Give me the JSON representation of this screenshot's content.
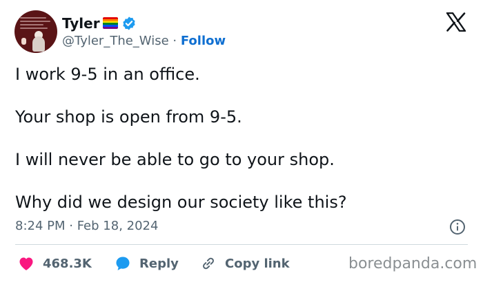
{
  "author": {
    "display_name": "Tyler",
    "handle": "@Tyler_The_Wise",
    "separator": "·",
    "follow_label": "Follow",
    "flag_icon": "rainbow-flag-icon",
    "verified_icon": "verified-badge-icon",
    "avatar_icon": "profile-avatar"
  },
  "platform_logo": "x-logo-icon",
  "tweet": {
    "lines": [
      "I work 9-5 in an office.",
      "Your shop is open from 9-5.",
      "I will never be able to go to your shop.",
      "Why did we design our society like this?"
    ],
    "timestamp": "8:24 PM · Feb 18, 2024"
  },
  "actions": {
    "like_count": "468.3K",
    "reply_label": "Reply",
    "copy_link_label": "Copy link"
  },
  "watermark": "boredpanda.com",
  "colors": {
    "accent_blue": "#1d9bf0",
    "follow_blue": "#0f6fd1",
    "like_red": "#f91880",
    "muted_text": "#536471",
    "divider": "#cfd9de",
    "flag": [
      "#e40303",
      "#ff8c00",
      "#ffed00",
      "#008026",
      "#004dff",
      "#750787"
    ]
  }
}
